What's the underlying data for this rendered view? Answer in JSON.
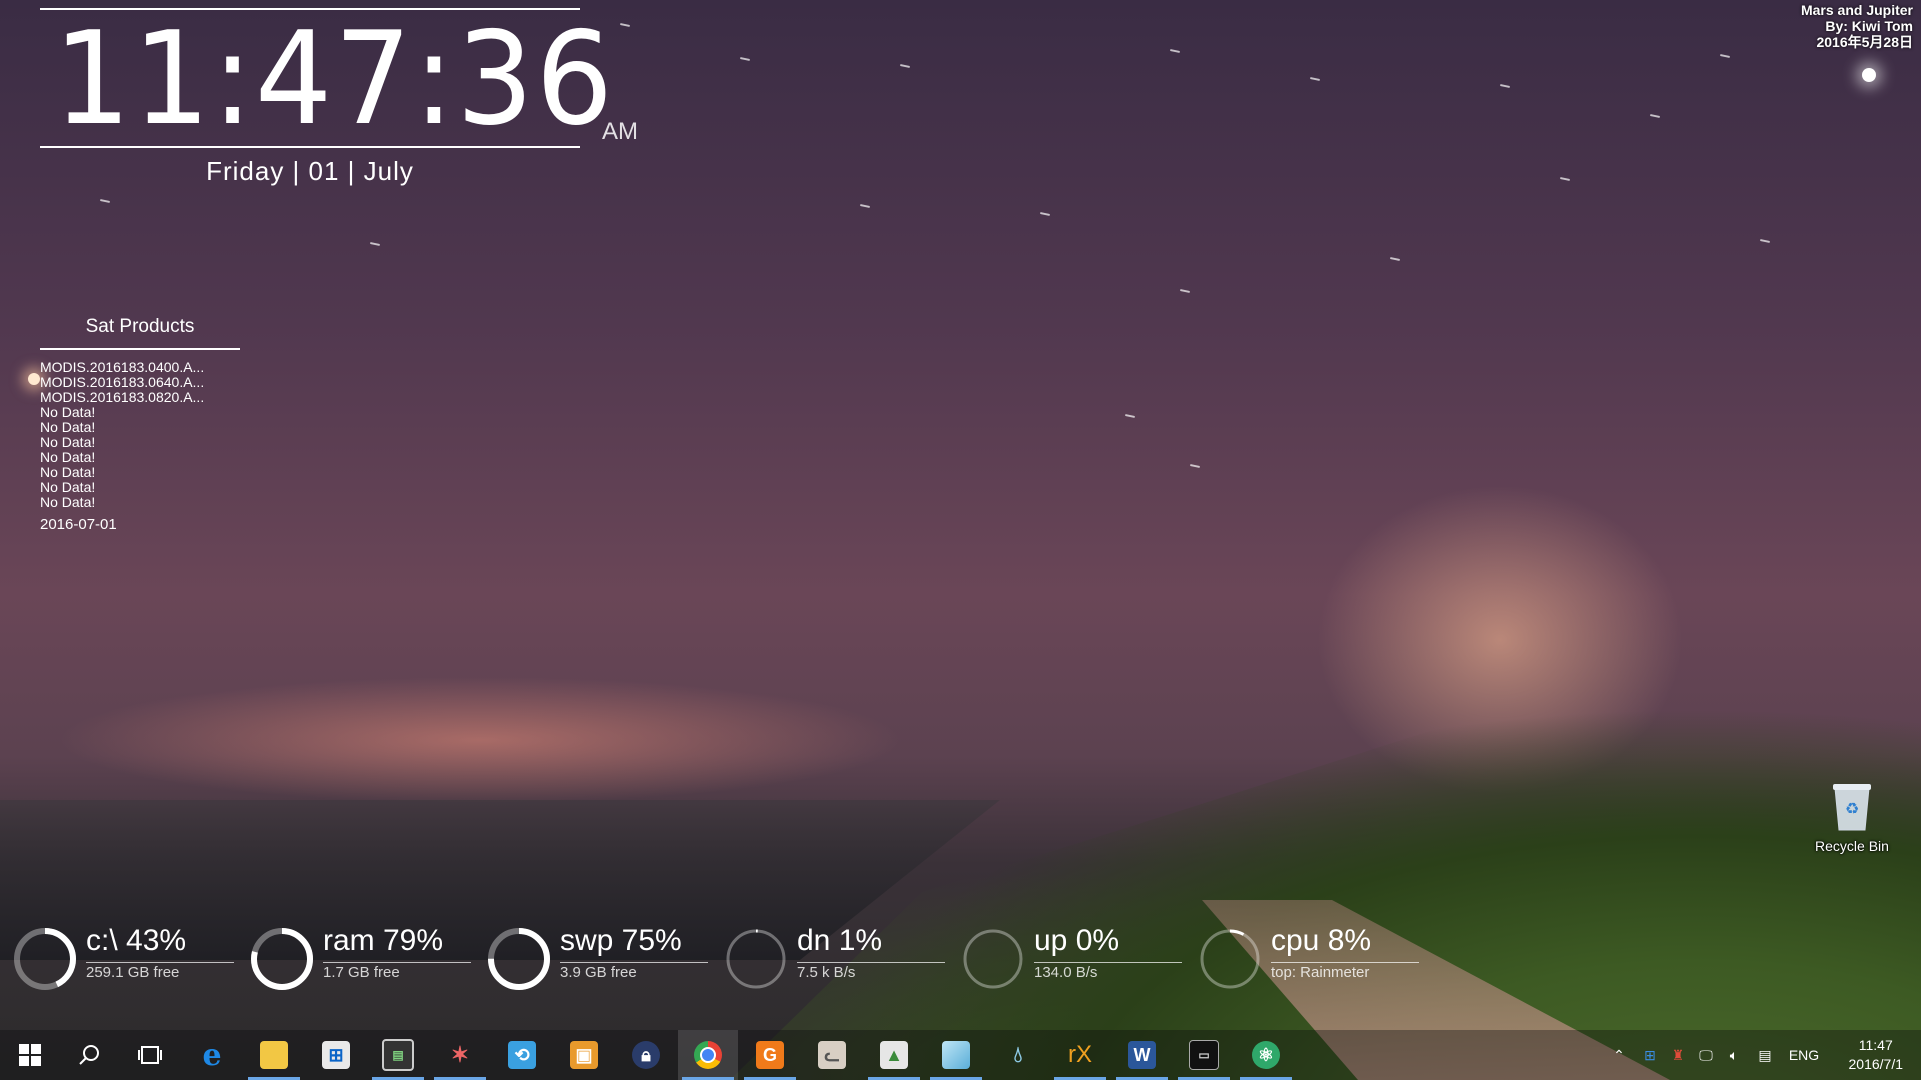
{
  "clock": {
    "time": "11:47:36",
    "ampm": "AM",
    "date": "Friday | 01 | July"
  },
  "credit": {
    "title": "Mars and Jupiter",
    "author": "By: Kiwi Tom",
    "date": "2016年5月28日"
  },
  "sat_products": {
    "title": "Sat Products",
    "items": [
      "MODIS.2016183.0400.A...",
      "MODIS.2016183.0640.A...",
      "MODIS.2016183.0820.A...",
      "No Data!",
      "No Data!",
      "No Data!",
      "No Data!",
      "No Data!",
      "No Data!",
      "No Data!"
    ],
    "date": "2016-07-01"
  },
  "gauges": [
    {
      "label": "c:\\ 43%",
      "detail": "259.1 GB free",
      "percent": 43
    },
    {
      "label": "ram 79%",
      "detail": "1.7 GB free",
      "percent": 79
    },
    {
      "label": "swp 75%",
      "detail": "3.9 GB free",
      "percent": 75
    },
    {
      "label": "dn 1%",
      "detail": "7.5 k B/s",
      "percent": 1
    },
    {
      "label": "up 0%",
      "detail": "134.0  B/s",
      "percent": 0
    },
    {
      "label": "cpu 8%",
      "detail": "top: Rainmeter",
      "percent": 8
    }
  ],
  "desktop": {
    "recycle_bin": "Recycle Bin"
  },
  "taskbar": {
    "language": "ENG",
    "time": "11:47",
    "date": "2016/7/1",
    "accent_color": "#6aa6e6"
  }
}
